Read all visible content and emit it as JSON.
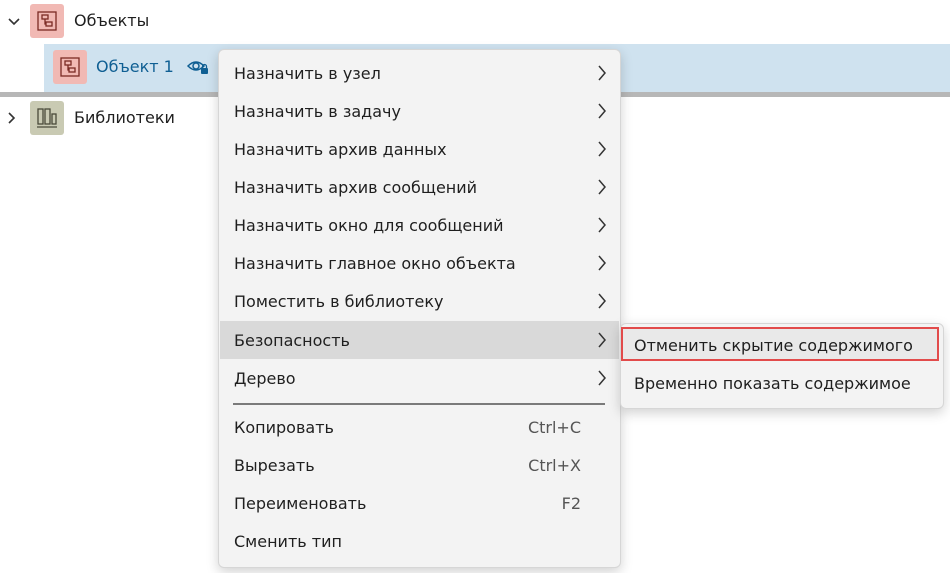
{
  "tree": {
    "objects": {
      "label": "Объекты",
      "icon": "object-tree-icon"
    },
    "object1": {
      "label": "Объект 1",
      "icon": "object-tree-icon",
      "badge": "hidden-eye-icon"
    },
    "libraries": {
      "label": "Библиотеки",
      "icon": "library-icon"
    }
  },
  "context_menu": {
    "items": [
      {
        "label": "Назначить в узел"
      },
      {
        "label": "Назначить в задачу"
      },
      {
        "label": "Назначить архив данных"
      },
      {
        "label": "Назначить архив сообщений"
      },
      {
        "label": "Назначить окно для сообщений"
      },
      {
        "label": "Назначить главное окно объекта"
      },
      {
        "label": "Поместить в библиотеку"
      },
      {
        "label": "Безопасность"
      },
      {
        "label": "Дерево"
      },
      {
        "label": "Копировать",
        "shortcut": "Ctrl+C"
      },
      {
        "label": "Вырезать",
        "shortcut": "Ctrl+X"
      },
      {
        "label": "Переименовать",
        "shortcut": "F2"
      },
      {
        "label": "Сменить тип"
      }
    ]
  },
  "security_submenu": {
    "items": [
      {
        "label": "Отменить скрытие содержимого"
      },
      {
        "label": "Временно показать содержимое"
      }
    ]
  },
  "colors": {
    "selection": "#cfe2ef",
    "highlight": "#d9d9d9",
    "focus_border": "#e24b4b",
    "object_icon_bg": "#f1b9b4",
    "library_icon_bg": "#c9cab3"
  }
}
